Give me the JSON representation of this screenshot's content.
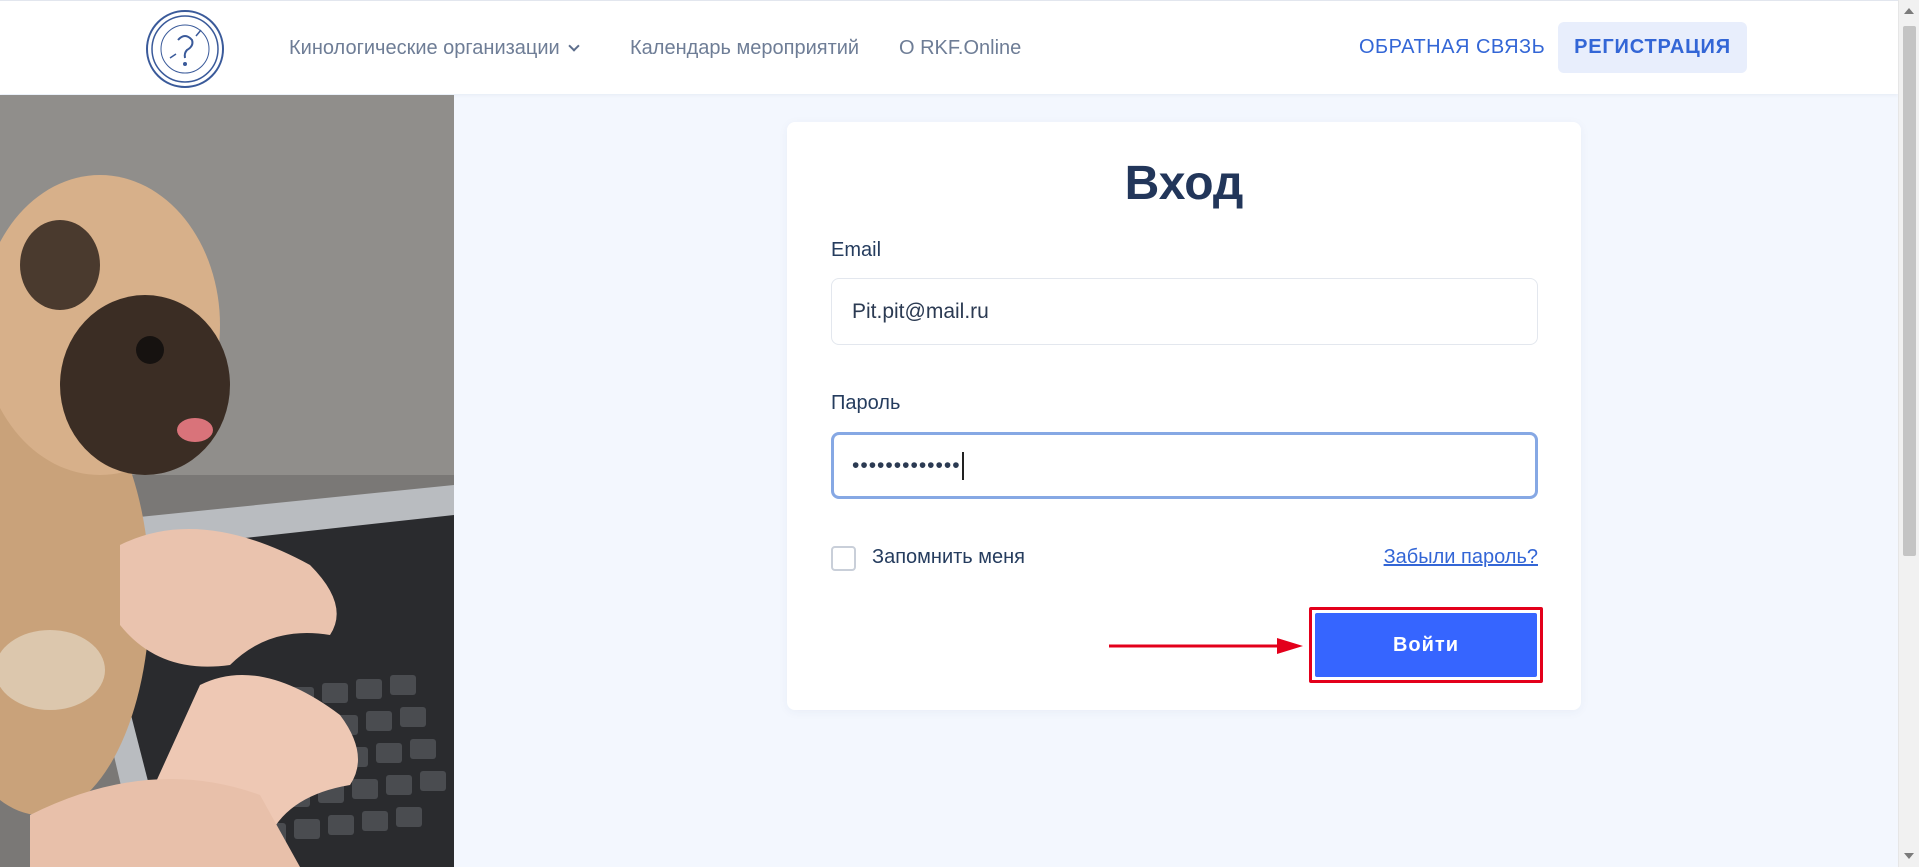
{
  "header": {
    "logo_icon": "rkf-logo-icon",
    "nav": {
      "organizations": "Кинологические организации",
      "calendar": "Календарь мероприятий",
      "about": "О RKF.Online"
    },
    "feedback": "ОБРАТНАЯ СВЯЗЬ",
    "register": "РЕГИСТРАЦИЯ"
  },
  "login": {
    "title": "Вход",
    "email_label": "Email",
    "email_value": "Pit.pit@mail.ru",
    "password_label": "Пароль",
    "password_value": "•••••••••••••",
    "remember_label": "Запомнить меня",
    "forgot_link": "Забыли пароль?",
    "submit_label": "Войти"
  },
  "colors": {
    "accent": "#3366d6",
    "button": "#3665ff",
    "highlight": "#e3001b",
    "background": "#f3f7fe"
  }
}
